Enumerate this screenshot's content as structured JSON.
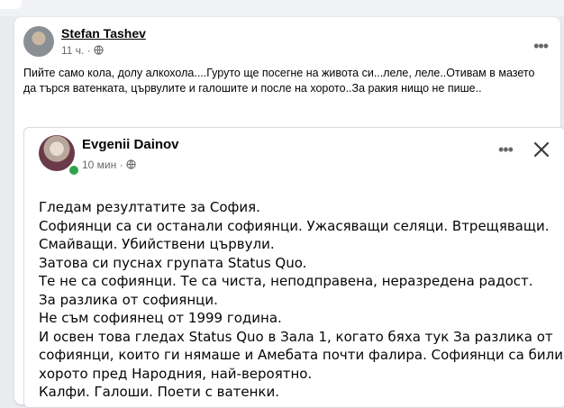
{
  "post": {
    "author": "Stefan Tashev",
    "time": "11 ч.",
    "separator": "·",
    "text": "Пийте само кола, долу алкохола....Гуруто ще посегне на живота си...леле, леле..Отивам в мазето да търся ватенката, цървулите и галошите и после на хорото..За ракия нищо не пише..",
    "menu_icon": "more-dots-icon",
    "privacy_icon": "globe-icon"
  },
  "shared_post": {
    "author": "Evgenii Dainov",
    "time": "10 мин",
    "separator": "·",
    "online_status_color": "#31a24c",
    "menu_icon": "more-dots-icon",
    "close_icon": "close-icon",
    "privacy_icon": "globe-icon",
    "lines": [
      "Гледам резултатите за София.",
      "Софиянци са си останали софиянци. Ужасяващи селяци. Втрещяващи.",
      "Смайващи. Убийствени цървули.",
      "Затова си пуснах групата Status Quo.",
      "Те не са софиянци. Те са чиста, неподправена, неразредена радост.",
      "За разлика от софиянци.",
      "Не съм софиянец от 1999 година.",
      "И освен това гледах Status Quo в Зала 1, когато бяха тук За разлика от",
      "софиянци, които ги нямаше и Амебата почти фалира. Софиянци са били на",
      "хорото пред Народния, най-вероятно.",
      "Калфи. Галоши. Поети с ватенки."
    ]
  }
}
